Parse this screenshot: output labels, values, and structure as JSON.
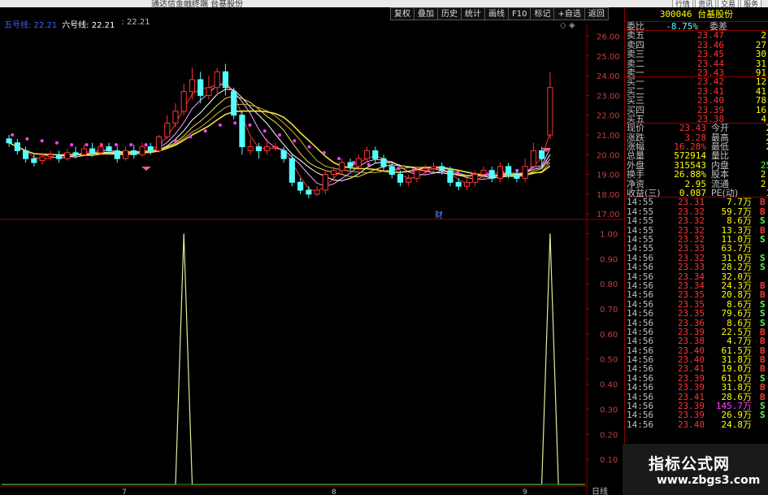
{
  "window": {
    "title": "通达信金融终端 台基股份",
    "tabs": [
      "行情",
      "资讯",
      "交易",
      "服务"
    ]
  },
  "toolbar": {
    "buttons": [
      "复权",
      "叠加",
      "历史",
      "统计",
      "画线",
      "F10",
      "标记",
      "+自选",
      "返回"
    ]
  },
  "indicators": {
    "ma5_label": "五号线: 22.21",
    "ma6_label": "六号线: 22.21",
    "ma_other": ": 22.21"
  },
  "colors": {
    "up": "#ff3232",
    "down": "#54ffff",
    "axis": "#8b0000",
    "ma_yellow": "#f0e040",
    "ma_magenta": "#ff40ff",
    "indicator": "#e8e89a"
  },
  "chart_data": [
    {
      "type": "candlestick",
      "name": "price",
      "ylim": [
        16.8,
        26.6
      ],
      "y_ticks": [
        "26.00",
        "25.00",
        "24.00",
        "23.00",
        "22.00",
        "21.00",
        "20.00",
        "19.00",
        "18.00",
        "17.00"
      ],
      "candles": [
        [
          20.8,
          20.6,
          21.0,
          20.4
        ],
        [
          20.6,
          20.2,
          20.8,
          20.0
        ],
        [
          20.2,
          19.8,
          20.4,
          19.6
        ],
        [
          19.8,
          19.6,
          20.0,
          19.4
        ],
        [
          19.7,
          19.9,
          20.1,
          19.5
        ],
        [
          19.9,
          20.0,
          20.2,
          19.7
        ],
        [
          20.0,
          19.8,
          20.2,
          19.6
        ],
        [
          19.8,
          20.1,
          20.3,
          19.7
        ],
        [
          20.1,
          20.0,
          20.4,
          19.8
        ],
        [
          20.0,
          20.3,
          20.5,
          19.9
        ],
        [
          20.3,
          20.1,
          20.6,
          19.9
        ],
        [
          20.1,
          20.4,
          20.6,
          20.0
        ],
        [
          20.4,
          20.2,
          20.6,
          20.0
        ],
        [
          20.2,
          19.8,
          20.4,
          19.6
        ],
        [
          19.8,
          20.2,
          20.4,
          19.7
        ],
        [
          20.2,
          20.0,
          20.5,
          19.8
        ],
        [
          20.0,
          20.4,
          20.6,
          19.9
        ],
        [
          20.4,
          20.2,
          20.6,
          20.0
        ],
        [
          20.2,
          20.9,
          21.0,
          20.1
        ],
        [
          20.9,
          21.6,
          22.0,
          20.8
        ],
        [
          21.6,
          22.2,
          22.6,
          21.4
        ],
        [
          22.2,
          23.2,
          23.6,
          22.0
        ],
        [
          23.2,
          23.8,
          24.4,
          22.8
        ],
        [
          23.8,
          23.0,
          24.2,
          22.6
        ],
        [
          23.0,
          23.4,
          24.0,
          22.8
        ],
        [
          23.4,
          24.2,
          24.4,
          23.0
        ],
        [
          24.2,
          23.4,
          24.6,
          23.0
        ],
        [
          23.2,
          22.0,
          23.4,
          21.8
        ],
        [
          22.0,
          20.4,
          22.2,
          20.0
        ],
        [
          20.2,
          20.4,
          20.8,
          20.0
        ],
        [
          20.4,
          20.2,
          20.6,
          19.8
        ],
        [
          20.2,
          20.4,
          20.8,
          20.0
        ],
        [
          20.4,
          20.4,
          20.6,
          20.2
        ],
        [
          20.2,
          19.8,
          20.4,
          19.6
        ],
        [
          19.8,
          18.6,
          20.0,
          18.4
        ],
        [
          18.6,
          18.2,
          18.8,
          18.0
        ],
        [
          18.2,
          18.0,
          18.4,
          17.8
        ],
        [
          18.0,
          18.2,
          18.4,
          17.9
        ],
        [
          18.2,
          19.0,
          19.2,
          18.0
        ],
        [
          19.0,
          19.2,
          19.4,
          18.8
        ],
        [
          19.2,
          19.6,
          19.8,
          19.0
        ],
        [
          19.6,
          19.4,
          19.8,
          19.2
        ],
        [
          19.4,
          19.8,
          20.0,
          19.2
        ],
        [
          19.8,
          20.2,
          20.4,
          19.6
        ],
        [
          20.2,
          19.8,
          20.4,
          19.6
        ],
        [
          19.8,
          19.4,
          20.0,
          19.2
        ],
        [
          19.4,
          19.0,
          19.6,
          18.8
        ],
        [
          19.0,
          18.6,
          19.2,
          18.4
        ],
        [
          18.6,
          18.8,
          19.0,
          18.4
        ],
        [
          18.8,
          19.2,
          19.4,
          18.6
        ],
        [
          19.2,
          19.3,
          19.5,
          19.0
        ],
        [
          19.3,
          19.4,
          19.6,
          19.1
        ],
        [
          19.4,
          19.2,
          19.6,
          19.0
        ],
        [
          19.2,
          18.6,
          19.4,
          18.4
        ],
        [
          18.6,
          18.4,
          18.8,
          18.2
        ],
        [
          18.4,
          18.6,
          18.8,
          18.2
        ],
        [
          18.6,
          19.0,
          19.2,
          18.4
        ],
        [
          19.0,
          19.2,
          19.4,
          18.8
        ],
        [
          19.2,
          18.8,
          19.4,
          18.6
        ],
        [
          18.8,
          19.4,
          19.6,
          18.6
        ],
        [
          19.4,
          19.0,
          19.6,
          18.8
        ],
        [
          19.0,
          18.8,
          19.2,
          18.6
        ],
        [
          18.8,
          19.4,
          19.8,
          18.6
        ],
        [
          19.4,
          20.2,
          20.6,
          19.2
        ],
        [
          20.2,
          19.8,
          20.4,
          19.4
        ],
        [
          21.0,
          23.4,
          24.2,
          20.8
        ]
      ],
      "ma_values": [
        21.0,
        20.8,
        20.7,
        20.6,
        20.5,
        20.5,
        20.5,
        20.5,
        20.5,
        20.5,
        20.6,
        20.7,
        20.9,
        21.2,
        21.5,
        21.6,
        21.5,
        21.2,
        21.0,
        20.7,
        20.4,
        20.1,
        19.8,
        19.6,
        19.5,
        19.4,
        19.3,
        19.2,
        19.2,
        19.1,
        19.1,
        19.0,
        19.0,
        19.1,
        19.2,
        19.4,
        19.6
      ],
      "markers_pink": "above",
      "annotation": "财"
    },
    {
      "type": "line",
      "name": "indicator",
      "ylim": [
        0.0,
        1.05
      ],
      "y_ticks": [
        "1.00",
        "0.90",
        "0.80",
        "0.70",
        "0.60",
        "0.50",
        "0.40",
        "0.30",
        "0.20",
        "0.10"
      ],
      "x": [
        0,
        20,
        21,
        22,
        64,
        65,
        66
      ],
      "y": [
        0,
        0,
        1.0,
        0,
        0,
        1.0,
        0
      ],
      "date_labels": [
        "7",
        "8",
        "9"
      ]
    }
  ],
  "quote_panel": {
    "header": "300046 台基股份",
    "webi_label": "委比",
    "webi_value": "-8.75%",
    "wecha_label": "委差",
    "asks": [
      {
        "label": "卖五",
        "price": "23.47",
        "vol": "2"
      },
      {
        "label": "卖四",
        "price": "23.46",
        "vol": "27"
      },
      {
        "label": "卖三",
        "price": "23.45",
        "vol": "30"
      },
      {
        "label": "卖二",
        "price": "23.44",
        "vol": "31"
      },
      {
        "label": "卖一",
        "price": "23.43",
        "vol": "91"
      }
    ],
    "bids": [
      {
        "label": "买一",
        "price": "23.42",
        "vol": "12"
      },
      {
        "label": "买二",
        "price": "23.41",
        "vol": "41"
      },
      {
        "label": "买三",
        "price": "23.40",
        "vol": "78"
      },
      {
        "label": "买四",
        "price": "23.39",
        "vol": "16"
      },
      {
        "label": "买五",
        "price": "23.38",
        "vol": "4"
      }
    ],
    "stats": [
      {
        "l": "现价",
        "m": "23.43",
        "l2": "今开",
        "r2": "2"
      },
      {
        "l": "涨跌",
        "m": "3.28",
        "l2": "最高",
        "r2": "2"
      },
      {
        "l": "涨幅",
        "m": "16.28%",
        "l2": "最低",
        "r2": "2"
      },
      {
        "l": "总量",
        "m": "572914",
        "l2": "量比",
        "r2": ""
      },
      {
        "l": "外盘",
        "m": "315543",
        "l2": "内盘",
        "r2": "25"
      },
      {
        "l": "换手",
        "m": "26.88%",
        "l2": "股本",
        "r2": "2."
      },
      {
        "l": "净资",
        "m": "2.95",
        "l2": "流通",
        "r2": "2."
      },
      {
        "l": "收益(三)",
        "m": "0.087",
        "l2": "PE(动)",
        "r2": "1"
      }
    ],
    "ticks": [
      {
        "t": "14:55",
        "p": "23.31",
        "v": "7.7万",
        "d": "B"
      },
      {
        "t": "14:55",
        "p": "23.32",
        "v": "59.7万",
        "d": "B"
      },
      {
        "t": "14:55",
        "p": "23.32",
        "v": "8.6万",
        "d": "S"
      },
      {
        "t": "14:55",
        "p": "23.32",
        "v": "13.3万",
        "d": "B"
      },
      {
        "t": "14:55",
        "p": "23.32",
        "v": "11.0万",
        "d": "S"
      },
      {
        "t": "14:55",
        "p": "23.33",
        "v": "63.7万",
        "d": ""
      },
      {
        "t": "14:56",
        "p": "23.32",
        "v": "31.0万",
        "d": "S"
      },
      {
        "t": "14:56",
        "p": "23.33",
        "v": "28.2万",
        "d": "S"
      },
      {
        "t": "14:56",
        "p": "23.34",
        "v": "32.0万",
        "d": ""
      },
      {
        "t": "14:56",
        "p": "23.34",
        "v": "24.3万",
        "d": "B"
      },
      {
        "t": "14:56",
        "p": "23.35",
        "v": "20.8万",
        "d": "B"
      },
      {
        "t": "14:56",
        "p": "23.35",
        "v": "8.6万",
        "d": "S"
      },
      {
        "t": "14:56",
        "p": "23.35",
        "v": "79.6万",
        "d": "S"
      },
      {
        "t": "14:56",
        "p": "23.36",
        "v": "8.6万",
        "d": "S"
      },
      {
        "t": "14:56",
        "p": "23.39",
        "v": "22.5万",
        "d": "B"
      },
      {
        "t": "14:56",
        "p": "23.38",
        "v": "4.7万",
        "d": "B"
      },
      {
        "t": "14:56",
        "p": "23.40",
        "v": "61.5万",
        "d": "B"
      },
      {
        "t": "14:56",
        "p": "23.40",
        "v": "31.8万",
        "d": "B"
      },
      {
        "t": "14:56",
        "p": "23.41",
        "v": "19.0万",
        "d": "B"
      },
      {
        "t": "14:56",
        "p": "23.39",
        "v": "61.0万",
        "d": "S"
      },
      {
        "t": "14:56",
        "p": "23.39",
        "v": "31.8万",
        "d": "B"
      },
      {
        "t": "14:56",
        "p": "23.41",
        "v": "28.6万",
        "d": "B"
      },
      {
        "t": "14:56",
        "p": "23.39",
        "v": "145.7万",
        "d": "S"
      },
      {
        "t": "14:56",
        "p": "23.39",
        "v": "26.9万",
        "d": "S"
      },
      {
        "t": "14:56",
        "p": "23.40",
        "v": "24.8万",
        "d": ""
      }
    ]
  },
  "watermark": {
    "line1": "指标公式网",
    "line2": "www.zbgs3.com"
  },
  "bottom_tab": "日线"
}
